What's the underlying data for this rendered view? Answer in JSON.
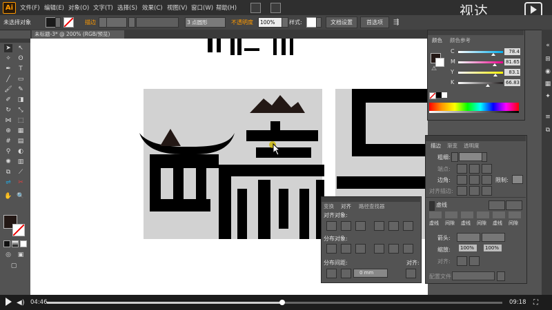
{
  "app": {
    "logo": "Ai"
  },
  "menu": [
    "文件(F)",
    "编辑(E)",
    "对象(O)",
    "文字(T)",
    "选择(S)",
    "效果(C)",
    "视图(V)",
    "窗口(W)",
    "帮助(H)"
  ],
  "brand": {
    "text": "视达"
  },
  "control_bar": {
    "selection": "未选择对象",
    "stroke_label": "描边",
    "stroke_value": "",
    "brush": "3 点圆形",
    "opacity_label": "不透明度",
    "opacity_value": "100%",
    "style_label": "样式:",
    "doc_setup": "文档设置",
    "preferences": "首选项"
  },
  "document_tab": {
    "title": "未标题-3* @ 200% (RGB/预览)"
  },
  "color_panel": {
    "tabs": [
      "颜色",
      "颜色参考"
    ],
    "channels": [
      {
        "label": "C",
        "value": "78.4",
        "fraction": 0.784,
        "color": "#00aeef"
      },
      {
        "label": "M",
        "value": "81.65",
        "fraction": 0.8165,
        "color": "#ec008c"
      },
      {
        "label": "Y",
        "value": "83.1",
        "fraction": 0.831,
        "color": "#fff200"
      },
      {
        "label": "K",
        "value": "66.83",
        "fraction": 0.6683,
        "color": "#231f20"
      }
    ]
  },
  "stroke_panel": {
    "tabs": [
      "描边",
      "渐变",
      "透明度"
    ],
    "weight_label": "粗细:",
    "cap_label": "端点:",
    "corner_label": "边角:",
    "limit_label": "限制:",
    "align_label": "对齐描边:",
    "dashed_label": "虚线",
    "dash_cells": [
      "虚线",
      "间隙",
      "虚线",
      "间隙",
      "虚线",
      "间隙"
    ],
    "arrow_label": "箭头:",
    "scale_label": "缩放:",
    "scale_values": [
      "100%",
      "100%"
    ],
    "align2_label": "对齐:",
    "profile_label": "配置文件:"
  },
  "align_panel": {
    "tabs": [
      "变换",
      "对齐",
      "路径查找器"
    ],
    "align_objects": "对齐对象:",
    "distribute_objects": "分布对象:",
    "distribute_spacing": "分布间距:",
    "align_to": "对齐:",
    "spacing_value": "0 mm"
  },
  "player": {
    "current_time": "04:46",
    "total_time": "09:18",
    "progress": 0.517
  },
  "colors": {
    "accent": "#ff9a00",
    "ink": "#000000",
    "mountain": "#231815",
    "artboard_gray": "#d2d2d2"
  }
}
